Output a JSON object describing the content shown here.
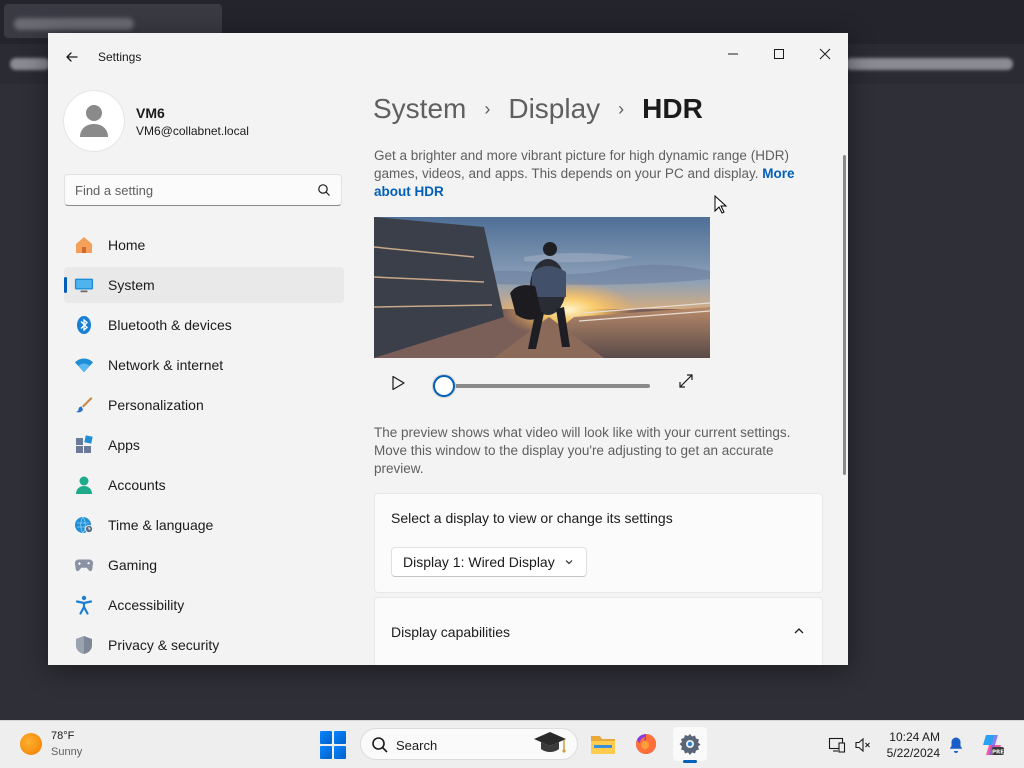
{
  "window": {
    "title": "Settings"
  },
  "profile": {
    "name": "VM6",
    "email": "VM6@collabnet.local"
  },
  "search": {
    "placeholder": "Find a setting"
  },
  "nav": [
    {
      "label": "Home",
      "icon": "home-icon"
    },
    {
      "label": "System",
      "icon": "monitor-icon",
      "active": true
    },
    {
      "label": "Bluetooth & devices",
      "icon": "bluetooth-icon"
    },
    {
      "label": "Network & internet",
      "icon": "wifi-icon"
    },
    {
      "label": "Personalization",
      "icon": "brush-icon"
    },
    {
      "label": "Apps",
      "icon": "apps-icon"
    },
    {
      "label": "Accounts",
      "icon": "person-icon"
    },
    {
      "label": "Time & language",
      "icon": "globe-clock-icon"
    },
    {
      "label": "Gaming",
      "icon": "gamepad-icon"
    },
    {
      "label": "Accessibility",
      "icon": "accessibility-icon"
    },
    {
      "label": "Privacy & security",
      "icon": "shield-icon"
    }
  ],
  "breadcrumb": {
    "items": [
      "System",
      "Display",
      "HDR"
    ]
  },
  "content": {
    "description": "Get a brighter and more vibrant picture for high dynamic range (HDR) games, videos, and apps. This depends on your PC and display.",
    "more_link": "More about HDR",
    "video_progress": 0,
    "preview_note": "The preview shows what video will look like with your current settings. Move this window to the display you're adjusting to get an accurate preview.",
    "select_display_label": "Select a display to view or change its settings",
    "selected_display": "Display 1: Wired Display",
    "capabilities_label": "Display capabilities"
  },
  "taskbar": {
    "weather_temp": "78°F",
    "weather_cond": "Sunny",
    "search_label": "Search",
    "time": "10:24 AM",
    "date": "5/22/2024",
    "apps": [
      "file-explorer-icon",
      "firefox-icon",
      "settings-icon"
    ]
  },
  "colors": {
    "accent": "#005fb8",
    "window_bg": "#f3f3f3",
    "card_bg": "#fbfbfb"
  }
}
